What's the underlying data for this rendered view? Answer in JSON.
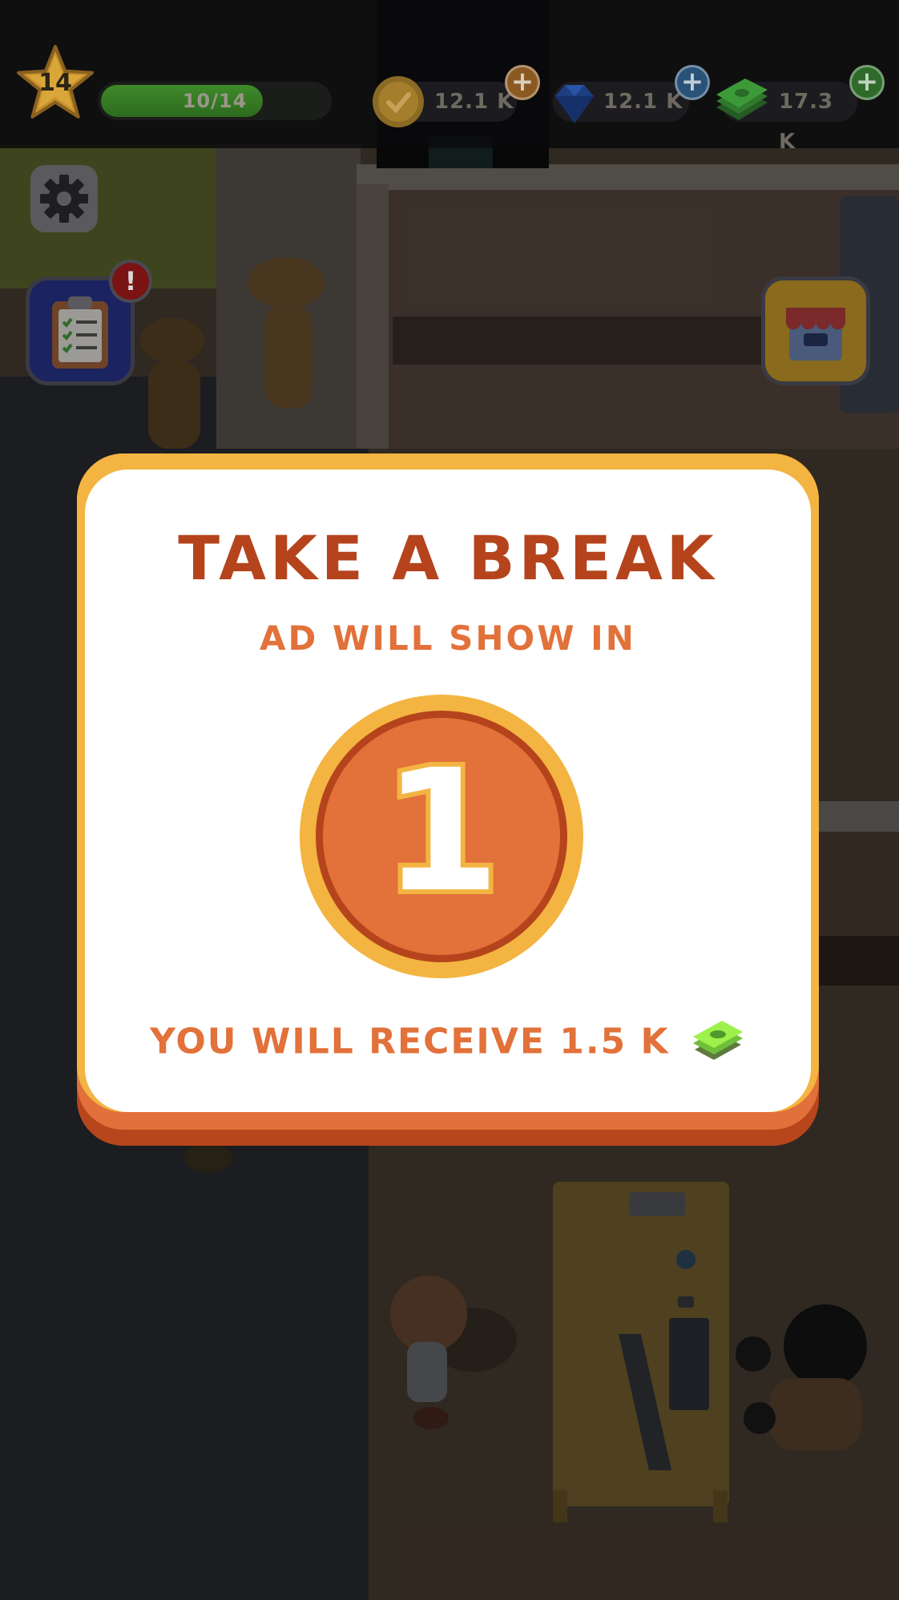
{
  "hud": {
    "level": "14",
    "xp_text": "10/14",
    "xp_progress": 0.71,
    "currencies": [
      {
        "name": "coins",
        "value": "12.1 K",
        "icon": "coin-icon",
        "color": "#f3b441"
      },
      {
        "name": "gems",
        "value": "12.1 K",
        "icon": "gem-icon",
        "color": "#2f6fd6"
      },
      {
        "name": "cash",
        "value": "17.3 K",
        "icon": "cash-icon",
        "color": "#55c545"
      }
    ]
  },
  "buttons": {
    "settings_icon": "gear-icon",
    "tasks_icon": "clipboard-icon",
    "tasks_badge": "!",
    "shop_icon": "shop-icon"
  },
  "modal": {
    "title": "TAKE A BREAK",
    "subtitle": "AD WILL SHOW IN",
    "countdown": "1",
    "reward_text": "YOU WILL RECEIVE 1.5 K",
    "reward_icon": "cash-stack-icon"
  },
  "colors": {
    "title": "#b5441c",
    "accent_orange": "#e2713a",
    "accent_yellow": "#f3b441"
  }
}
